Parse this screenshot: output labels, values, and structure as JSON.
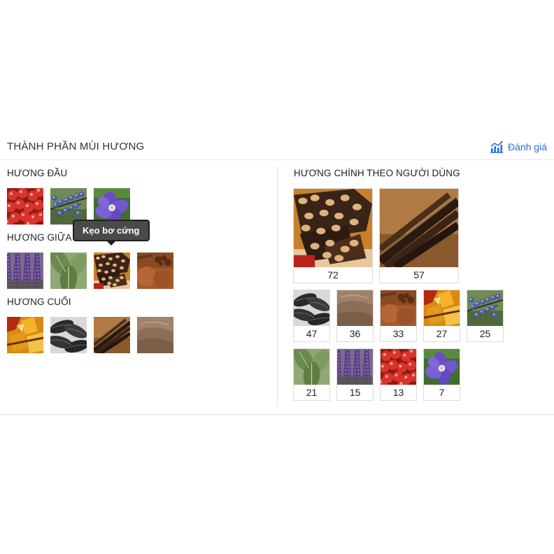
{
  "header": {
    "title": "THÀNH PHẦN MÙI HƯƠNG",
    "rate_label": "Đánh giá",
    "rate_icon": "chart-icon",
    "accent_color": "#2b6fd6"
  },
  "notes": {
    "top": {
      "label": "HƯƠNG ĐẦU",
      "items": [
        {
          "icon": "red-berries-icon"
        },
        {
          "icon": "blueberry-branch-icon"
        },
        {
          "icon": "purple-flower-icon"
        }
      ]
    },
    "middle": {
      "label": "HƯƠNG GIỮA",
      "items": [
        {
          "icon": "lavender-icon"
        },
        {
          "icon": "sage-leaves-icon"
        },
        {
          "icon": "nut-brittle-icon"
        },
        {
          "icon": "cinnamon-spice-icon"
        }
      ]
    },
    "base": {
      "label": "HƯƠNG CUỐI",
      "items": [
        {
          "icon": "amber-resin-icon"
        },
        {
          "icon": "tonka-bean-icon"
        },
        {
          "icon": "vanilla-pod-icon"
        },
        {
          "icon": "suede-leather-icon"
        }
      ]
    }
  },
  "tooltip": {
    "text": "Kẹo bơ cứng"
  },
  "user_notes": {
    "label": "HƯƠNG CHÍNH THEO NGƯỜI DÙNG",
    "items": [
      {
        "icon": "nut-brittle-icon",
        "count": "72"
      },
      {
        "icon": "vanilla-pod-icon",
        "count": "57"
      },
      {
        "icon": "tonka-bean-icon",
        "count": "47"
      },
      {
        "icon": "suede-leather-icon",
        "count": "36"
      },
      {
        "icon": "cinnamon-spice-icon",
        "count": "33"
      },
      {
        "icon": "amber-resin-icon",
        "count": "27"
      },
      {
        "icon": "blueberry-branch-icon",
        "count": "25"
      },
      {
        "icon": "sage-leaves-icon",
        "count": "21"
      },
      {
        "icon": "lavender-icon",
        "count": "15"
      },
      {
        "icon": "red-berries-icon",
        "count": "13"
      },
      {
        "icon": "purple-flower-icon",
        "count": "7"
      }
    ]
  }
}
